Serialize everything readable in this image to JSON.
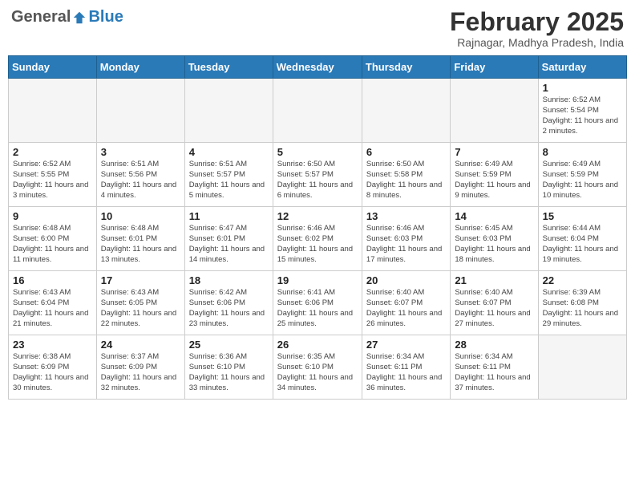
{
  "header": {
    "logo_general": "General",
    "logo_blue": "Blue",
    "month_title": "February 2025",
    "subtitle": "Rajnagar, Madhya Pradesh, India"
  },
  "weekdays": [
    "Sunday",
    "Monday",
    "Tuesday",
    "Wednesday",
    "Thursday",
    "Friday",
    "Saturday"
  ],
  "weeks": [
    [
      {
        "day": "",
        "info": ""
      },
      {
        "day": "",
        "info": ""
      },
      {
        "day": "",
        "info": ""
      },
      {
        "day": "",
        "info": ""
      },
      {
        "day": "",
        "info": ""
      },
      {
        "day": "",
        "info": ""
      },
      {
        "day": "1",
        "info": "Sunrise: 6:52 AM\nSunset: 5:54 PM\nDaylight: 11 hours and 2 minutes."
      }
    ],
    [
      {
        "day": "2",
        "info": "Sunrise: 6:52 AM\nSunset: 5:55 PM\nDaylight: 11 hours and 3 minutes."
      },
      {
        "day": "3",
        "info": "Sunrise: 6:51 AM\nSunset: 5:56 PM\nDaylight: 11 hours and 4 minutes."
      },
      {
        "day": "4",
        "info": "Sunrise: 6:51 AM\nSunset: 5:57 PM\nDaylight: 11 hours and 5 minutes."
      },
      {
        "day": "5",
        "info": "Sunrise: 6:50 AM\nSunset: 5:57 PM\nDaylight: 11 hours and 6 minutes."
      },
      {
        "day": "6",
        "info": "Sunrise: 6:50 AM\nSunset: 5:58 PM\nDaylight: 11 hours and 8 minutes."
      },
      {
        "day": "7",
        "info": "Sunrise: 6:49 AM\nSunset: 5:59 PM\nDaylight: 11 hours and 9 minutes."
      },
      {
        "day": "8",
        "info": "Sunrise: 6:49 AM\nSunset: 5:59 PM\nDaylight: 11 hours and 10 minutes."
      }
    ],
    [
      {
        "day": "9",
        "info": "Sunrise: 6:48 AM\nSunset: 6:00 PM\nDaylight: 11 hours and 11 minutes."
      },
      {
        "day": "10",
        "info": "Sunrise: 6:48 AM\nSunset: 6:01 PM\nDaylight: 11 hours and 13 minutes."
      },
      {
        "day": "11",
        "info": "Sunrise: 6:47 AM\nSunset: 6:01 PM\nDaylight: 11 hours and 14 minutes."
      },
      {
        "day": "12",
        "info": "Sunrise: 6:46 AM\nSunset: 6:02 PM\nDaylight: 11 hours and 15 minutes."
      },
      {
        "day": "13",
        "info": "Sunrise: 6:46 AM\nSunset: 6:03 PM\nDaylight: 11 hours and 17 minutes."
      },
      {
        "day": "14",
        "info": "Sunrise: 6:45 AM\nSunset: 6:03 PM\nDaylight: 11 hours and 18 minutes."
      },
      {
        "day": "15",
        "info": "Sunrise: 6:44 AM\nSunset: 6:04 PM\nDaylight: 11 hours and 19 minutes."
      }
    ],
    [
      {
        "day": "16",
        "info": "Sunrise: 6:43 AM\nSunset: 6:04 PM\nDaylight: 11 hours and 21 minutes."
      },
      {
        "day": "17",
        "info": "Sunrise: 6:43 AM\nSunset: 6:05 PM\nDaylight: 11 hours and 22 minutes."
      },
      {
        "day": "18",
        "info": "Sunrise: 6:42 AM\nSunset: 6:06 PM\nDaylight: 11 hours and 23 minutes."
      },
      {
        "day": "19",
        "info": "Sunrise: 6:41 AM\nSunset: 6:06 PM\nDaylight: 11 hours and 25 minutes."
      },
      {
        "day": "20",
        "info": "Sunrise: 6:40 AM\nSunset: 6:07 PM\nDaylight: 11 hours and 26 minutes."
      },
      {
        "day": "21",
        "info": "Sunrise: 6:40 AM\nSunset: 6:07 PM\nDaylight: 11 hours and 27 minutes."
      },
      {
        "day": "22",
        "info": "Sunrise: 6:39 AM\nSunset: 6:08 PM\nDaylight: 11 hours and 29 minutes."
      }
    ],
    [
      {
        "day": "23",
        "info": "Sunrise: 6:38 AM\nSunset: 6:09 PM\nDaylight: 11 hours and 30 minutes."
      },
      {
        "day": "24",
        "info": "Sunrise: 6:37 AM\nSunset: 6:09 PM\nDaylight: 11 hours and 32 minutes."
      },
      {
        "day": "25",
        "info": "Sunrise: 6:36 AM\nSunset: 6:10 PM\nDaylight: 11 hours and 33 minutes."
      },
      {
        "day": "26",
        "info": "Sunrise: 6:35 AM\nSunset: 6:10 PM\nDaylight: 11 hours and 34 minutes."
      },
      {
        "day": "27",
        "info": "Sunrise: 6:34 AM\nSunset: 6:11 PM\nDaylight: 11 hours and 36 minutes."
      },
      {
        "day": "28",
        "info": "Sunrise: 6:34 AM\nSunset: 6:11 PM\nDaylight: 11 hours and 37 minutes."
      },
      {
        "day": "",
        "info": ""
      }
    ]
  ]
}
